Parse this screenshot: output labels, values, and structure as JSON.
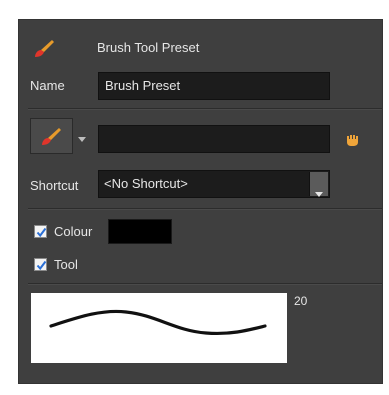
{
  "header": {
    "title": "Brush Tool Preset"
  },
  "name": {
    "label": "Name",
    "value": "Brush Preset"
  },
  "preset_row": {
    "value": ""
  },
  "shortcut": {
    "label": "Shortcut",
    "selected": "<No Shortcut>"
  },
  "colour": {
    "label": "Colour",
    "checked": true,
    "swatch": "#000000"
  },
  "tool": {
    "label": "Tool",
    "checked": true
  },
  "brush_preview": {
    "size": "20"
  },
  "icons": {
    "header_icon": "brush-icon",
    "tool_button_icon": "brush-icon",
    "dropdown_arrow": "triangle-down-icon",
    "presets_icon": "hand-icon",
    "select_arrow": "chevron-down-icon"
  },
  "colors": {
    "panel": "#3f3f3f",
    "field": "#1c1c1c",
    "accent_brush": "#e0352b",
    "checkbox_tick": "#2a6fd6"
  }
}
